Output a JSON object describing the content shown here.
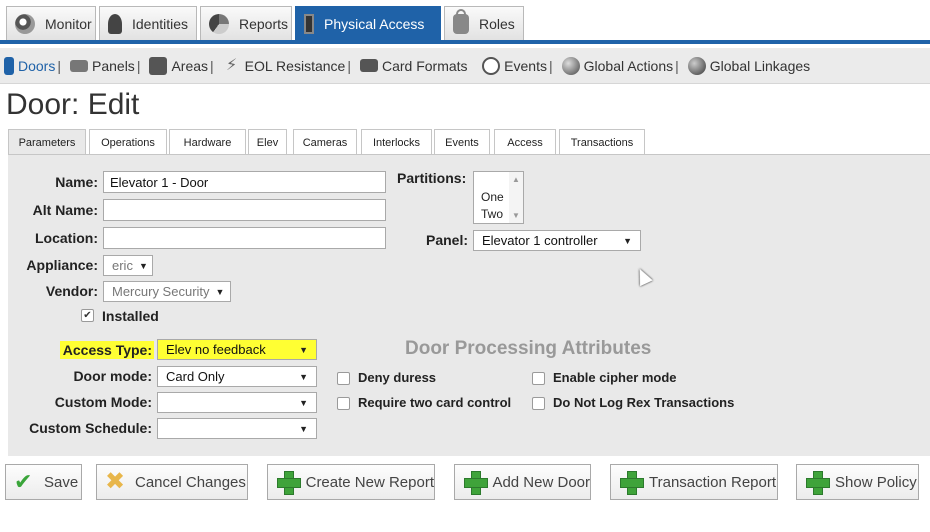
{
  "top_nav": {
    "tabs": [
      {
        "label": "Monitor",
        "icon": "monitor-icon"
      },
      {
        "label": "Identities",
        "icon": "identities-icon"
      },
      {
        "label": "Reports",
        "icon": "reports-icon"
      },
      {
        "label": "Physical Access",
        "icon": "door-icon",
        "active": true
      },
      {
        "label": "Roles",
        "icon": "lock-icon"
      }
    ]
  },
  "sub_nav": {
    "items": [
      {
        "label": "Doors",
        "icon": "door-icon",
        "active": true
      },
      {
        "label": "Panels",
        "icon": "panel-icon"
      },
      {
        "label": "Areas",
        "icon": "area-icon"
      },
      {
        "label": "EOL Resistance",
        "icon": "lightning-icon"
      },
      {
        "label": "Card Formats",
        "icon": "card-icon"
      },
      {
        "label": "Events",
        "icon": "clock-icon"
      },
      {
        "label": "Global Actions",
        "icon": "globe-icon"
      },
      {
        "label": "Global Linkages",
        "icon": "linkage-icon"
      }
    ],
    "separator": "|"
  },
  "page_title": "Door: Edit",
  "tabs": [
    "Parameters",
    "Operations",
    "Hardware",
    "Elev",
    "Cameras",
    "Interlocks",
    "Events",
    "Access",
    "Transactions"
  ],
  "form": {
    "name": {
      "label": "Name:",
      "value": "Elevator 1 - Door"
    },
    "alt_name": {
      "label": "Alt Name:",
      "value": ""
    },
    "location": {
      "label": "Location:",
      "value": ""
    },
    "appliance": {
      "label": "Appliance:",
      "value": "eric"
    },
    "vendor": {
      "label": "Vendor:",
      "value": "Mercury Security"
    },
    "installed": {
      "label": "Installed",
      "checked": true
    },
    "partitions": {
      "label": "Partitions:",
      "options": [
        "One",
        "Two"
      ]
    },
    "panel": {
      "label": "Panel:",
      "value": "Elevator 1 controller"
    },
    "access_type": {
      "label": "Access Type:",
      "value": "Elev no feedback",
      "highlight": "#ffff33"
    },
    "door_mode": {
      "label": "Door mode:",
      "value": "Card Only"
    },
    "custom_mode": {
      "label": "Custom Mode:",
      "value": ""
    },
    "custom_schedule": {
      "label": "Custom Schedule:",
      "value": ""
    }
  },
  "door_processing": {
    "title": "Door Processing Attributes",
    "attributes": [
      {
        "label": "Deny duress",
        "checked": false
      },
      {
        "label": "Enable cipher mode",
        "checked": false
      },
      {
        "label": "Require two card control",
        "checked": false
      },
      {
        "label": "Do Not Log Rex Transactions",
        "checked": false
      }
    ]
  },
  "buttons": {
    "save": "Save",
    "cancel": "Cancel Changes",
    "create_report": "Create New Report",
    "add_door": "Add New Door",
    "transaction_report": "Transaction Report",
    "show_policy": "Show Policy"
  },
  "colors": {
    "accent": "#1f62a8",
    "highlight": "#ffff33"
  }
}
